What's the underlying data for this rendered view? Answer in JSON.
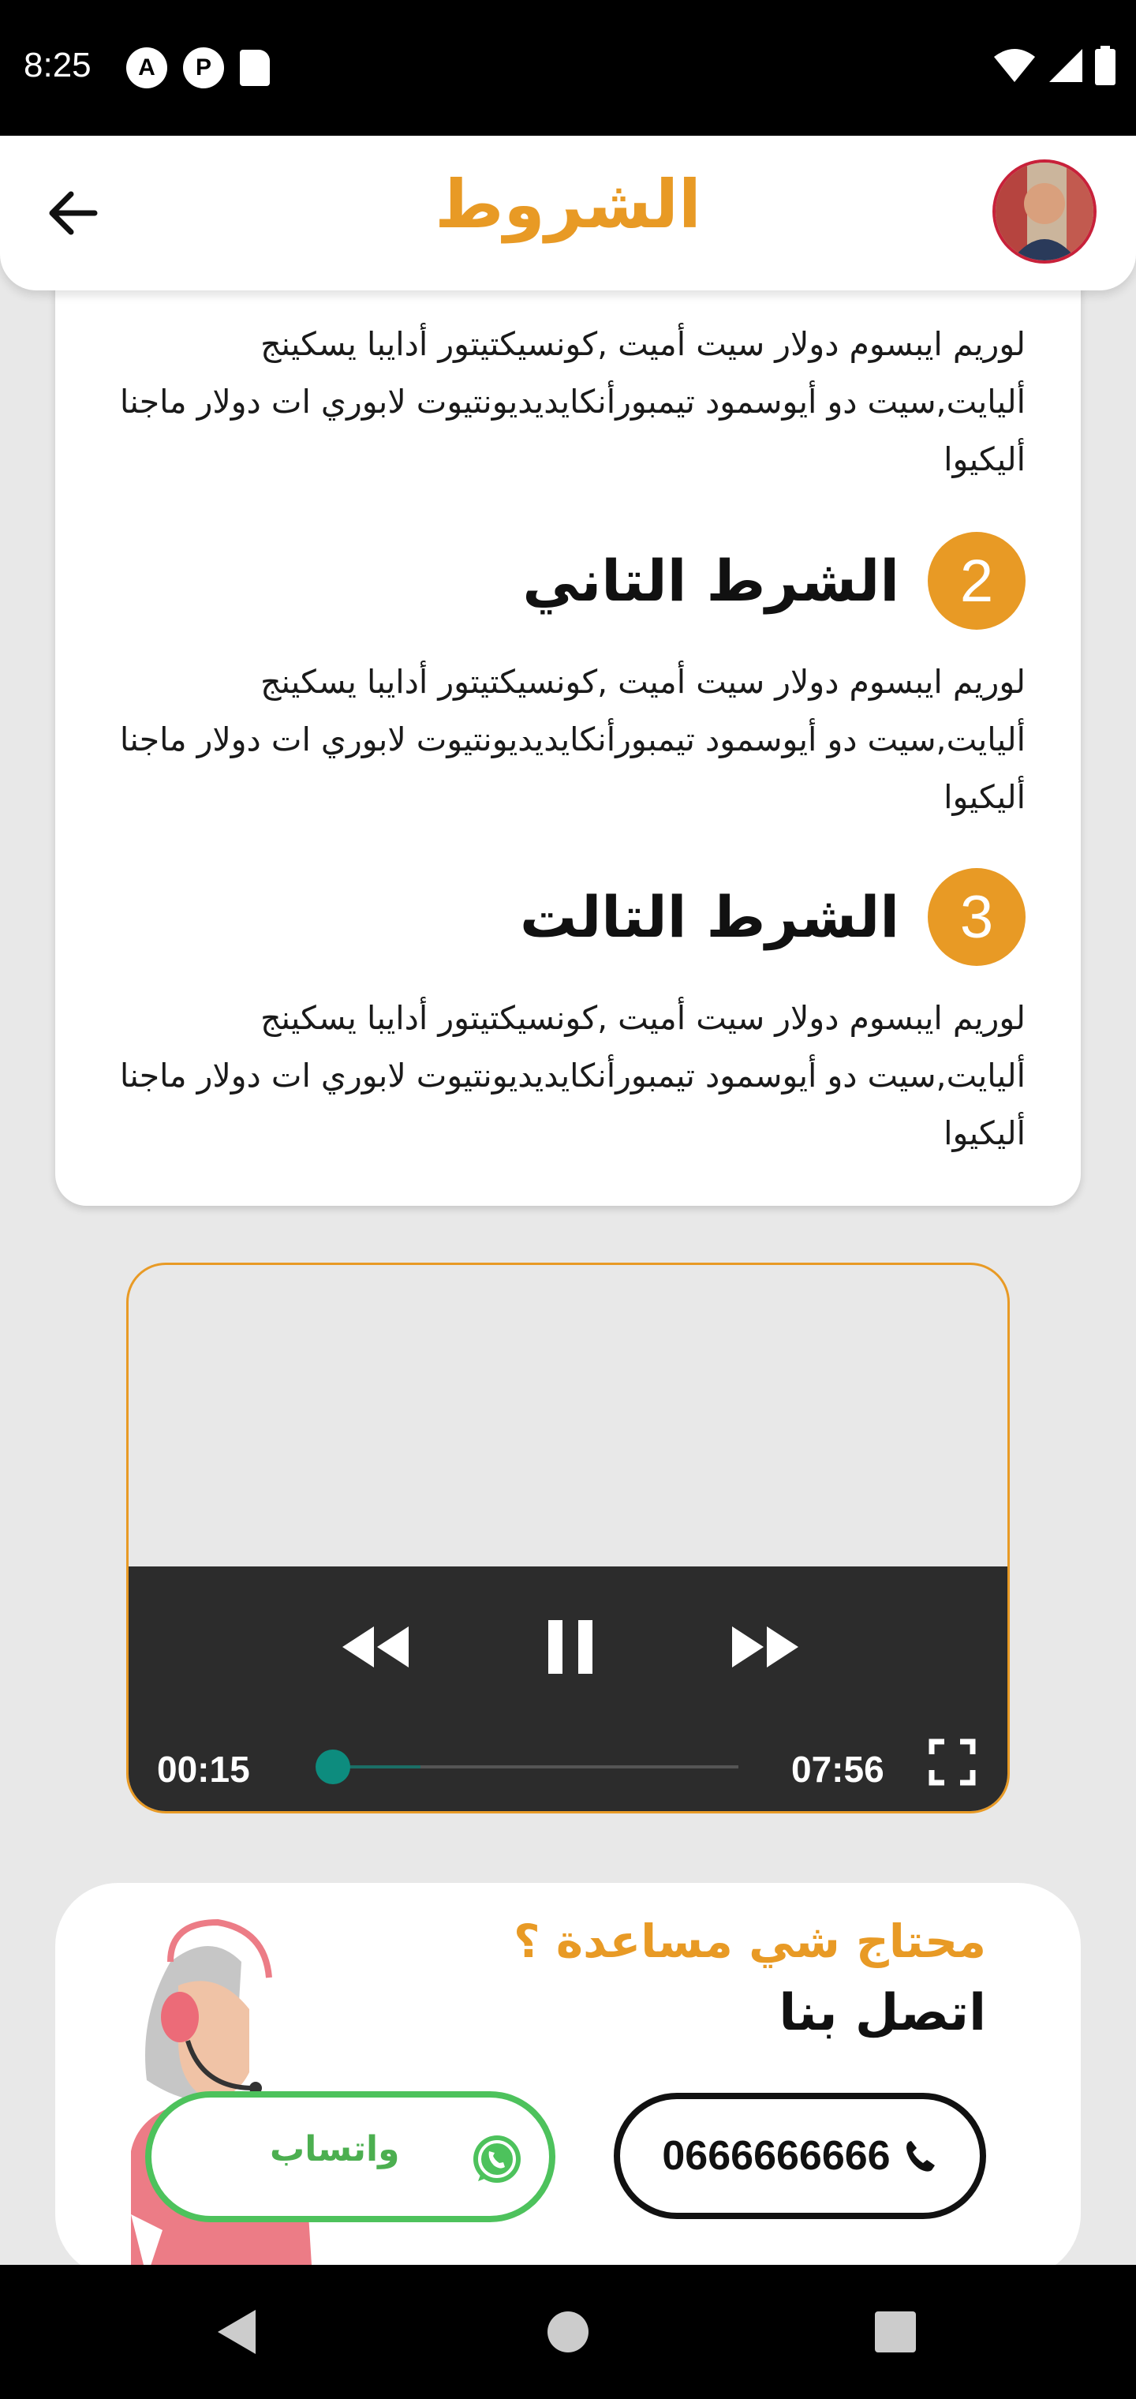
{
  "status_bar": {
    "time": "8:25",
    "left_icons": [
      "a-circle-icon",
      "p-circle-icon",
      "sd-card-icon"
    ],
    "right_icons": [
      "wifi-icon",
      "signal-icon",
      "battery-icon"
    ]
  },
  "header": {
    "title": "الشروط",
    "back_icon": "arrow-back-icon"
  },
  "terms": {
    "items": [
      {
        "number": "",
        "title": "",
        "text": "لوريم ايبسوم دولار سيت أميت ,كونسيكتيتور أدايبا يسكينج أليايت,سيت دو أيوسمود تيمبورأنكايديديونتيوت لابوري ات دولار ماجنا أليكيوا"
      },
      {
        "number": "2",
        "title": "الشرط التاني",
        "text": "لوريم ايبسوم دولار سيت أميت ,كونسيكتيتور أدايبا يسكينج أليايت,سيت دو أيوسمود تيمبورأنكايديديونتيوت لابوري ات دولار ماجنا أليكيوا"
      },
      {
        "number": "3",
        "title": "الشرط التالت",
        "text": "لوريم ايبسوم دولار سيت أميت ,كونسيكتيتور أدايبا يسكينج أليايت,سيت دو أيوسمود تيمبورأنكايديديونتيوت لابوري ات دولار ماجنا أليكيوا"
      }
    ]
  },
  "video": {
    "current_time": "00:15",
    "duration": "07:56",
    "progress_fraction": 0.03,
    "buffered_fraction": 0.24,
    "state": "playing"
  },
  "help": {
    "question": "محتاج شي مساعدة ؟",
    "contact_label": "اتصل بنا",
    "phone": "0666666666",
    "whatsapp_label": "واتساب"
  },
  "colors": {
    "accent": "#e89a25",
    "whatsapp": "#4dc25c",
    "seek": "#0d8c7e"
  }
}
